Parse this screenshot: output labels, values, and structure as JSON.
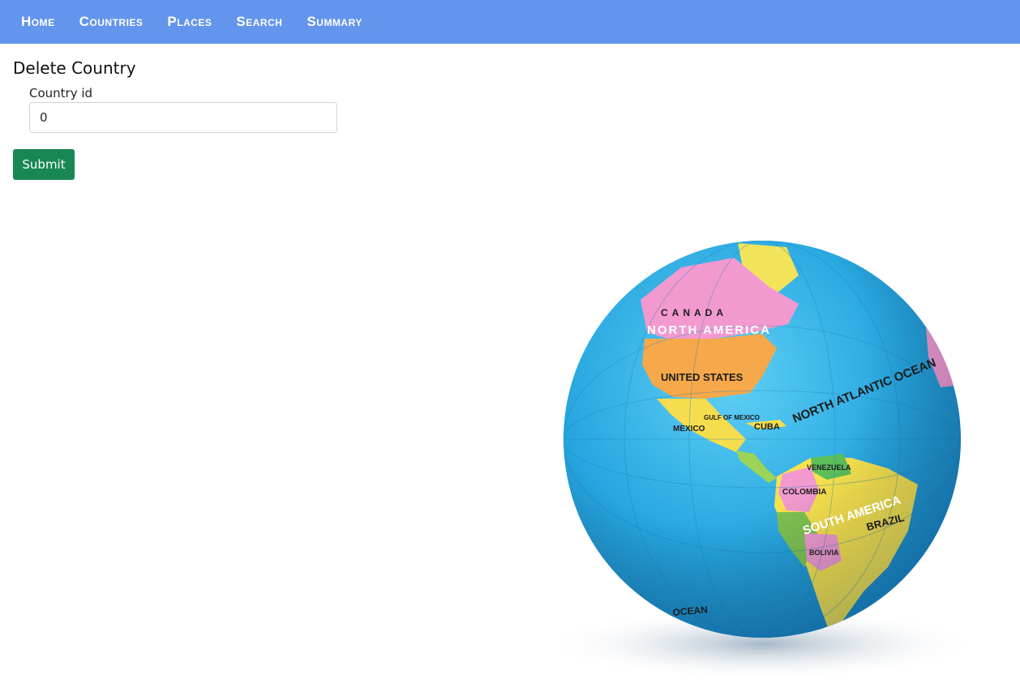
{
  "nav": {
    "items": [
      "Home",
      "Countries",
      "Places",
      "Search",
      "Summary"
    ]
  },
  "form": {
    "title": "Delete Country",
    "country_id_label": "Country id",
    "country_id_value": "0",
    "submit_label": "Submit"
  },
  "globe": {
    "labels": {
      "canada": "CANADA",
      "north_america": "NORTH AMERICA",
      "united_states": "UNITED STATES",
      "mexico": "MEXICO",
      "gulf_of_mexico": "GULF OF MEXICO",
      "cuba": "CUBA",
      "north_atlantic_ocean": "NORTH ATLANTIC OCEAN",
      "venezuela": "VENEZUELA",
      "colombia": "COLOMBIA",
      "south_america": "SOUTH AMERICA",
      "brazil": "BRAZIL",
      "bolivia": "BOLIVIA",
      "ocean": "OCEAN"
    }
  },
  "colors": {
    "navbar": "#6495ed",
    "submit": "#198754",
    "ocean": "#29a9e0"
  }
}
